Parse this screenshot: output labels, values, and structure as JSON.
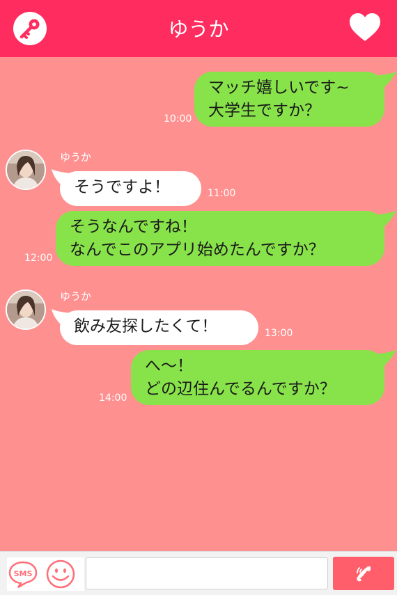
{
  "header": {
    "title": "ゆうか",
    "left_icon": "key-icon",
    "right_icon": "heart-icon"
  },
  "messages": [
    {
      "direction": "sent",
      "text": "マッチ嬉しいです~\n大学生ですか？",
      "time": "10:00"
    },
    {
      "direction": "received",
      "sender": "ゆうか",
      "text": "そうですよ！",
      "time": "11:00"
    },
    {
      "direction": "sent",
      "text": "そうなんですね！\nなんでこのアプリ始めたんですか？",
      "time": "12:00"
    },
    {
      "direction": "received",
      "sender": "ゆうか",
      "text": "飲み友探したくて！",
      "time": "13:00"
    },
    {
      "direction": "sent",
      "text": "へ～！\nどの辺住んでるんですか？",
      "time": "14:00"
    }
  ],
  "footer": {
    "sms_label": "SMS",
    "message_value": "",
    "icons": [
      "sms-icon",
      "smiley-icon",
      "phone-icon"
    ]
  },
  "colors": {
    "header": "#ff2d5f",
    "background": "#ff9090",
    "sent_bubble": "#88e34a",
    "received_bubble": "#ffffff",
    "call_button": "#ff5e6a"
  }
}
